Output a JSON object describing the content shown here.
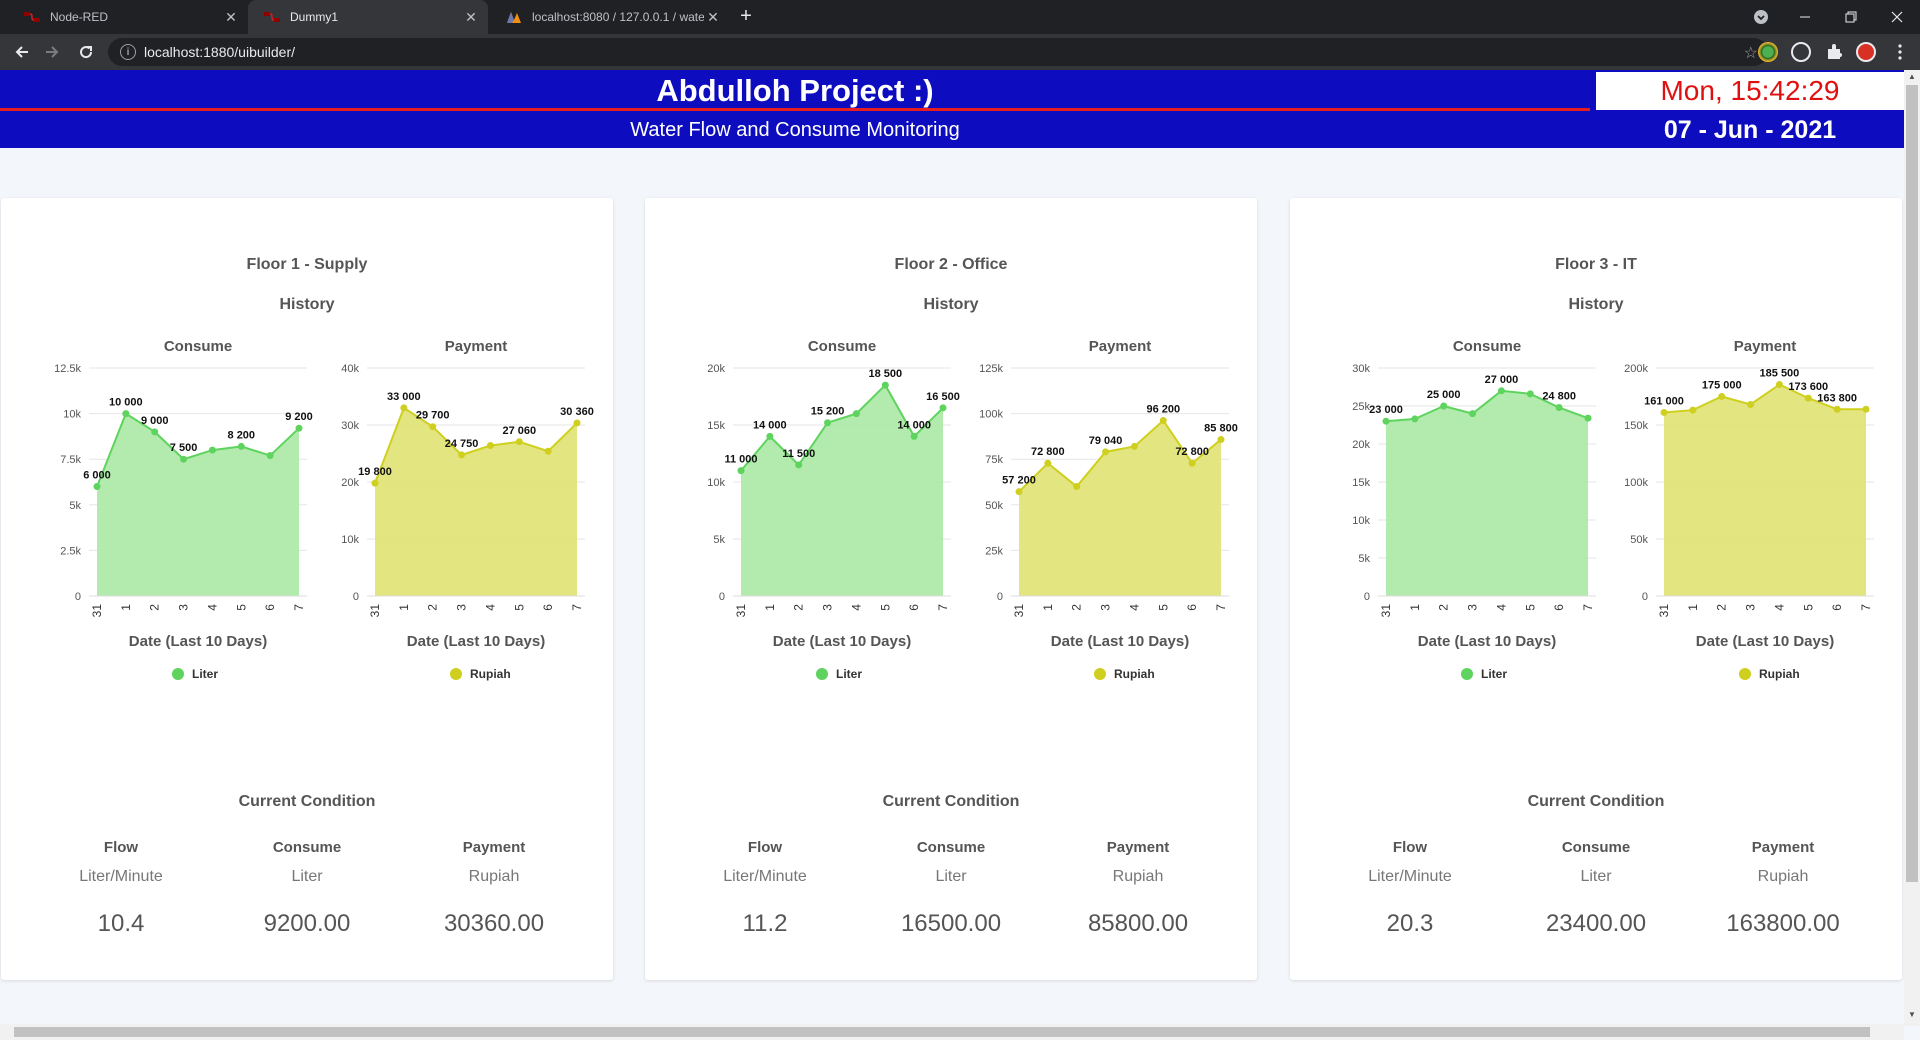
{
  "browser": {
    "tabs": [
      {
        "label": "Node-RED",
        "active": false,
        "icon": "node-red-icon"
      },
      {
        "label": "Dummy1",
        "active": true,
        "icon": "node-red-icon"
      },
      {
        "label": "localhost:8080 / 127.0.0.1 / wate",
        "active": false,
        "icon": "phpmyadmin-icon"
      }
    ],
    "new_tab_label": "+",
    "url": "localhost:1880/uibuilder/"
  },
  "header": {
    "title": "Abdulloh Project :)",
    "subtitle": "Water Flow and Consume Monitoring",
    "clock": "Mon, 15:42:29",
    "date": "07 - Jun - 2021"
  },
  "colors": {
    "header_bg": "#0d0dbf",
    "header_accent": "#e81e1e",
    "clock_text": "#e01010",
    "consume_line": "#5ed35e",
    "consume_fill": "#aeeaa9",
    "payment_line": "#cfcf1f",
    "payment_fill": "#e2e47a"
  },
  "cards": [
    {
      "title": "Floor 1 - Supply",
      "subtitle": "History",
      "current_title": "Current Condition",
      "metrics": [
        {
          "label": "Flow",
          "unit": "Liter/Minute",
          "value": "10.4"
        },
        {
          "label": "Consume",
          "unit": "Liter",
          "value": "9200.00"
        },
        {
          "label": "Payment",
          "unit": "Rupiah",
          "value": "30360.00"
        }
      ]
    },
    {
      "title": "Floor 2 - Office",
      "subtitle": "History",
      "current_title": "Current Condition",
      "metrics": [
        {
          "label": "Flow",
          "unit": "Liter/Minute",
          "value": "11.2"
        },
        {
          "label": "Consume",
          "unit": "Liter",
          "value": "16500.00"
        },
        {
          "label": "Payment",
          "unit": "Rupiah",
          "value": "85800.00"
        }
      ]
    },
    {
      "title": "Floor 3 - IT",
      "subtitle": "History",
      "current_title": "Current Condition",
      "metrics": [
        {
          "label": "Flow",
          "unit": "Liter/Minute",
          "value": "20.3"
        },
        {
          "label": "Consume",
          "unit": "Liter",
          "value": "23400.00"
        },
        {
          "label": "Payment",
          "unit": "Rupiah",
          "value": "163800.00"
        }
      ]
    }
  ],
  "chart_data": [
    {
      "type": "area",
      "title": "Consume",
      "xlabel": "Date (Last 10 Days)",
      "ylabel": "",
      "categories": [
        "31",
        "1",
        "2",
        "3",
        "4",
        "5",
        "6",
        "7"
      ],
      "series": [
        {
          "name": "Liter",
          "values": [
            6000,
            10000,
            9000,
            7500,
            8000,
            8200,
            7700,
            9200
          ]
        }
      ],
      "data_labels": [
        "6 000",
        "10 000",
        "9 000",
        "7 500",
        "",
        "8 200",
        "",
        "9 200"
      ],
      "ylim": [
        0,
        12500
      ],
      "yticks": [
        0,
        2500,
        5000,
        7500,
        10000,
        12500
      ],
      "ytick_labels": [
        "0",
        "2.5k",
        "5k",
        "7.5k",
        "10k",
        "12.5k"
      ],
      "color": "green",
      "grid": true,
      "legend": "bottom-center"
    },
    {
      "type": "area",
      "title": "Payment",
      "xlabel": "Date (Last 10 Days)",
      "ylabel": "",
      "categories": [
        "31",
        "1",
        "2",
        "3",
        "4",
        "5",
        "6",
        "7"
      ],
      "series": [
        {
          "name": "Rupiah",
          "values": [
            19800,
            33000,
            29700,
            24750,
            26400,
            27060,
            25400,
            30360
          ]
        }
      ],
      "data_labels": [
        "19 800",
        "33 000",
        "29 700",
        "24 750",
        "",
        "27 060",
        "",
        "30 360"
      ],
      "ylim": [
        0,
        40000
      ],
      "yticks": [
        0,
        10000,
        20000,
        30000,
        40000
      ],
      "ytick_labels": [
        "0",
        "10k",
        "20k",
        "30k",
        "40k"
      ],
      "color": "yellow",
      "grid": true,
      "legend": "bottom-center"
    },
    {
      "type": "area",
      "title": "Consume",
      "xlabel": "Date (Last 10 Days)",
      "ylabel": "",
      "categories": [
        "31",
        "1",
        "2",
        "3",
        "4",
        "5",
        "6",
        "7"
      ],
      "series": [
        {
          "name": "Liter",
          "values": [
            11000,
            14000,
            11500,
            15200,
            16000,
            18500,
            14000,
            16500
          ]
        }
      ],
      "data_labels": [
        "11 000",
        "14 000",
        "11 500",
        "15 200",
        "",
        "18 500",
        "14 000",
        "16 500"
      ],
      "ylim": [
        0,
        20000
      ],
      "yticks": [
        0,
        5000,
        10000,
        15000,
        20000
      ],
      "ytick_labels": [
        "0",
        "5k",
        "10k",
        "15k",
        "20k"
      ],
      "color": "green",
      "grid": true,
      "legend": "bottom-center"
    },
    {
      "type": "area",
      "title": "Payment",
      "xlabel": "Date (Last 10 Days)",
      "ylabel": "",
      "categories": [
        "31",
        "1",
        "2",
        "3",
        "4",
        "5",
        "6",
        "7"
      ],
      "series": [
        {
          "name": "Rupiah",
          "values": [
            57200,
            72800,
            60000,
            79040,
            82000,
            96200,
            72800,
            85800
          ]
        }
      ],
      "data_labels": [
        "57 200",
        "72 800",
        "",
        "79 040",
        "",
        "96 200",
        "72 800",
        "85 800"
      ],
      "ylim": [
        0,
        125000
      ],
      "yticks": [
        0,
        25000,
        50000,
        75000,
        100000,
        125000
      ],
      "ytick_labels": [
        "0",
        "25k",
        "50k",
        "75k",
        "100k",
        "125k"
      ],
      "color": "yellow",
      "grid": true,
      "legend": "bottom-center"
    },
    {
      "type": "area",
      "title": "Consume",
      "xlabel": "Date (Last 10 Days)",
      "ylabel": "",
      "categories": [
        "31",
        "1",
        "2",
        "3",
        "4",
        "5",
        "6",
        "7"
      ],
      "series": [
        {
          "name": "Liter",
          "values": [
            23000,
            23300,
            25000,
            24000,
            27000,
            26600,
            24800,
            23400
          ]
        }
      ],
      "data_labels": [
        "23 000",
        "",
        "25 000",
        "",
        "27 000",
        "",
        "24 800",
        ""
      ],
      "ylim": [
        0,
        30000
      ],
      "yticks": [
        0,
        5000,
        10000,
        15000,
        20000,
        25000,
        30000
      ],
      "ytick_labels": [
        "0",
        "5k",
        "10k",
        "15k",
        "20k",
        "25k",
        "30k"
      ],
      "color": "green",
      "grid": true,
      "legend": "bottom-center"
    },
    {
      "type": "area",
      "title": "Payment",
      "xlabel": "Date (Last 10 Days)",
      "ylabel": "",
      "categories": [
        "31",
        "1",
        "2",
        "3",
        "4",
        "5",
        "6",
        "7"
      ],
      "series": [
        {
          "name": "Rupiah",
          "values": [
            161000,
            163100,
            175000,
            168000,
            185500,
            173600,
            163800,
            163800
          ]
        }
      ],
      "data_labels": [
        "161 000",
        "",
        "175 000",
        "",
        "185 500",
        "173 600",
        "163 800",
        ""
      ],
      "ylim": [
        0,
        200000
      ],
      "yticks": [
        0,
        50000,
        100000,
        150000,
        200000
      ],
      "ytick_labels": [
        "0",
        "50k",
        "100k",
        "150k",
        "200k"
      ],
      "color": "yellow",
      "grid": true,
      "legend": "bottom-center"
    }
  ]
}
